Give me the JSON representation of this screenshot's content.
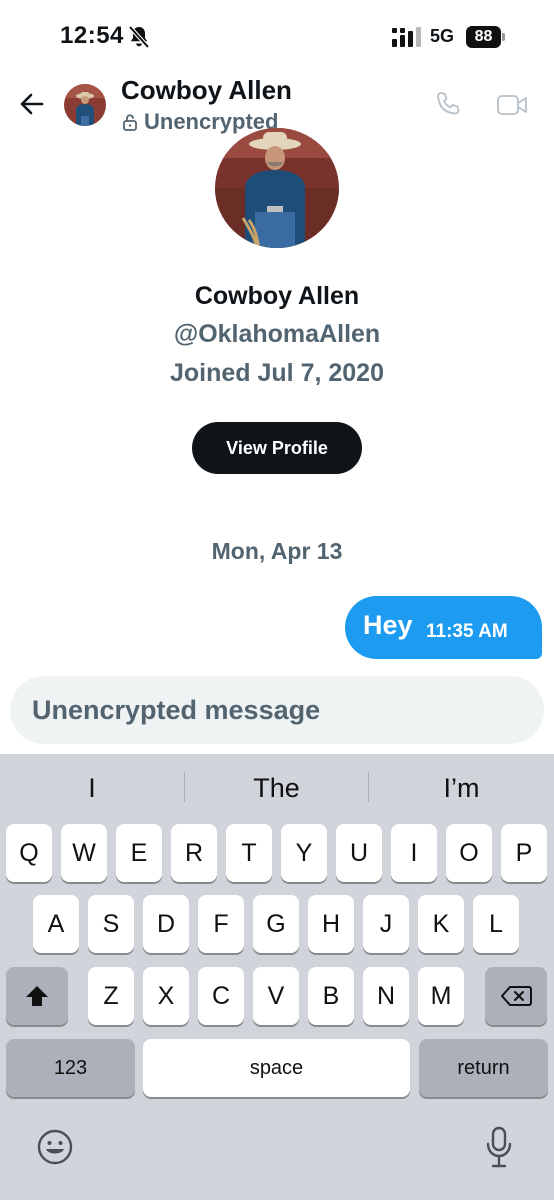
{
  "status_bar": {
    "time": "12:54",
    "network": "5G",
    "battery": "88",
    "icons": [
      "bell-muted-icon",
      "signal-icon",
      "battery-icon"
    ]
  },
  "header": {
    "name": "Cowboy Allen",
    "status": "Unencrypted",
    "icons": [
      "back-arrow-icon",
      "lock-open-icon",
      "phone-icon",
      "video-camera-icon"
    ]
  },
  "profile": {
    "name": "Cowboy Allen",
    "handle": "@OklahomaAllen",
    "joined": "Joined Jul 7, 2020",
    "view_profile_label": "View Profile"
  },
  "conversation": {
    "date": "Mon, Apr 13",
    "messages": [
      {
        "text": "Hey",
        "time": "11:35 AM",
        "sender": "me"
      }
    ]
  },
  "composer": {
    "placeholder": "Unencrypted message"
  },
  "keyboard": {
    "suggestions": [
      "I",
      "The",
      "I’m"
    ],
    "row1": [
      "Q",
      "W",
      "E",
      "R",
      "T",
      "Y",
      "U",
      "I",
      "O",
      "P"
    ],
    "row2": [
      "A",
      "S",
      "D",
      "F",
      "G",
      "H",
      "J",
      "K",
      "L"
    ],
    "row3": [
      "Z",
      "X",
      "C",
      "V",
      "B",
      "N",
      "M"
    ],
    "numbers_label": "123",
    "space_label": "space",
    "return_label": "return",
    "icons": [
      "shift-icon",
      "backspace-icon",
      "emoji-icon",
      "microphone-icon"
    ]
  },
  "colors": {
    "accent": "#1d9bf0",
    "text_primary": "#0f1419",
    "text_secondary": "#536471",
    "composer_bg": "#eff3f4",
    "keyboard_bg": "#d1d4db"
  }
}
